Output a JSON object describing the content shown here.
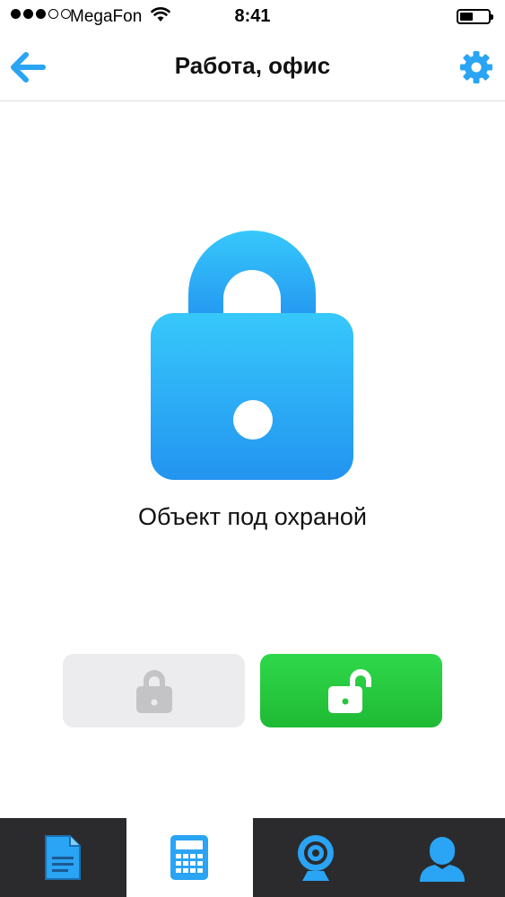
{
  "status_bar": {
    "carrier": "MegaFon",
    "time": "8:41",
    "signal_bars_filled": 3,
    "signal_bars_total": 5,
    "battery_level": 0.45
  },
  "nav": {
    "title": "Работа, офис",
    "back_icon": "arrow-left-icon",
    "settings_icon": "gear-icon"
  },
  "main": {
    "status_text": "Объект под охраной",
    "lock_state": "locked"
  },
  "controls": {
    "arm_icon": "lock-closed-icon",
    "disarm_icon": "lock-open-icon"
  },
  "tabs": [
    {
      "icon": "document-icon",
      "active": false
    },
    {
      "icon": "calculator-icon",
      "active": true
    },
    {
      "icon": "webcam-icon",
      "active": false
    },
    {
      "icon": "user-icon",
      "active": false
    }
  ],
  "colors": {
    "accent_blue": "#2aa4f4",
    "green": "#26c63d",
    "tab_bar_bg": "#2b2b2d",
    "disabled_gray": "#c4c4c6"
  }
}
